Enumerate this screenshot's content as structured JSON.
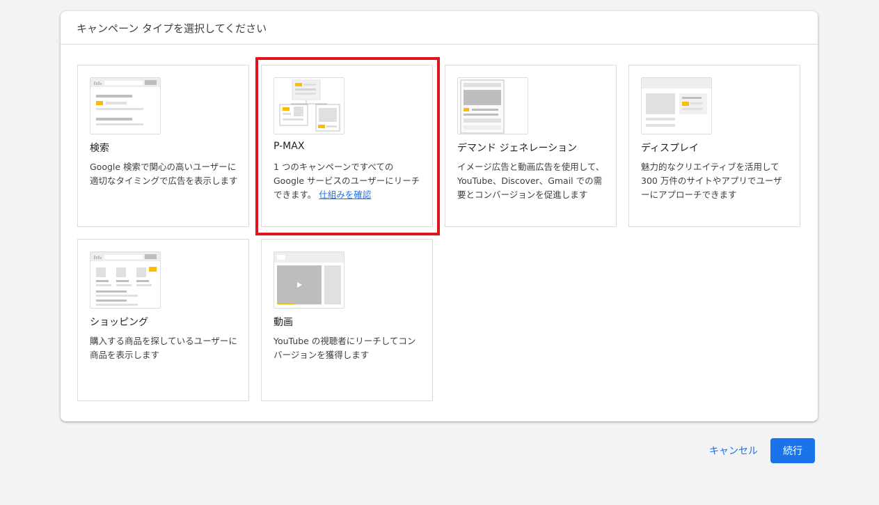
{
  "dialog": {
    "title": "キャンペーン タイプを選択してください"
  },
  "cards": [
    {
      "title": "検索",
      "description": "Google 検索で関心の高いユーザーに適切なタイミングで広告を表示します",
      "icon": "search-campaign-illustration-icon"
    },
    {
      "title": "P-MAX",
      "description": "1 つのキャンペーンですべての Google サービスのユーザーにリーチできます。",
      "link": "仕組みを確認",
      "icon": "performance-max-illustration-icon",
      "highlighted": true
    },
    {
      "title": "デマンド ジェネレーション",
      "description": "イメージ広告と動画広告を使用して、YouTube、Discover、Gmail での需要とコンバージョンを促進します",
      "icon": "demand-gen-illustration-icon"
    },
    {
      "title": "ディスプレイ",
      "description": "魅力的なクリエイティブを活用して 300 万件のサイトやアプリでユーザーにアプローチできます",
      "icon": "display-illustration-icon"
    },
    {
      "title": "ショッピング",
      "description": "購入する商品を探しているユーザーに商品を表示します",
      "icon": "shopping-illustration-icon"
    },
    {
      "title": "動画",
      "description": "YouTube の視聴者にリーチしてコンバージョンを獲得します",
      "icon": "video-illustration-icon"
    }
  ],
  "footer": {
    "cancel_label": "キャンセル",
    "continue_label": "続行"
  },
  "colors": {
    "accent": "#1a73e8",
    "illustration_yellow": "#fbbc04",
    "highlight_red": "#e0141c"
  }
}
